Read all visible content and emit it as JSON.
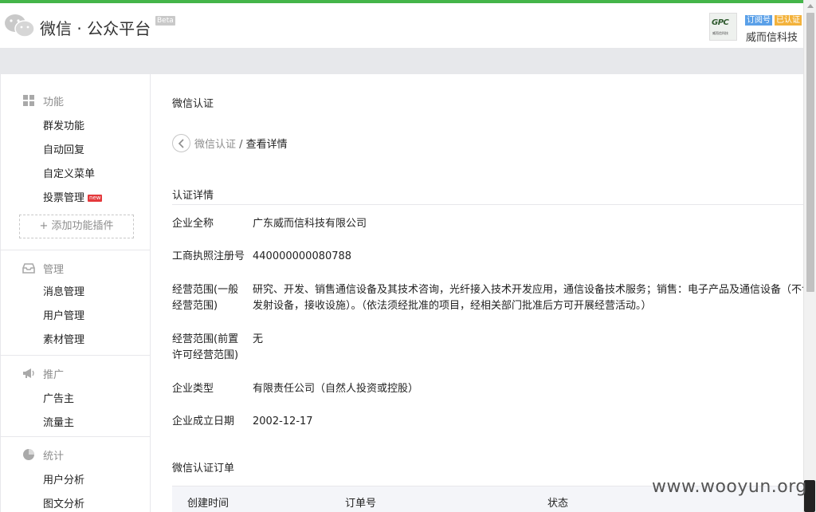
{
  "header": {
    "brand": "微信 · 公众平台",
    "beta": "Beta",
    "avatar_main": "GPC",
    "avatar_sub": "威而信科技",
    "tag_subscription": "订阅号",
    "tag_verified": "已认证",
    "account_name": "威而信科技"
  },
  "sidebar": {
    "function": {
      "title": "功能",
      "items": [
        "群发功能",
        "自动回复",
        "自定义菜单",
        "投票管理"
      ],
      "new_badge": "new",
      "add_plugin": "+ 添加功能插件"
    },
    "manage": {
      "title": "管理",
      "items": [
        "消息管理",
        "用户管理",
        "素材管理"
      ]
    },
    "promote": {
      "title": "推广",
      "items": [
        "广告主",
        "流量主"
      ]
    },
    "stats": {
      "title": "统计",
      "items": [
        "用户分析",
        "图文分析"
      ]
    }
  },
  "main": {
    "title": "微信认证",
    "breadcrumb": {
      "link": "微信认证",
      "sep": " / ",
      "current": "查看详情"
    },
    "details_title": "认证详情",
    "fields": [
      {
        "label": "企业全称",
        "value": [
          "广东威而信科技有限公司"
        ]
      },
      {
        "label": "工商执照注册号",
        "value": [
          "440000000080788"
        ]
      },
      {
        "label": "经营范围(一般经营范围)",
        "value": [
          "研究、开发、销售通信设备及其技术咨询，光纤接入技术开发应用，通信设备技术服务；销售：电子产品及通信设备（不含广播电视",
          "发射设备，接收设施）。（依法须经批准的项目，经相关部门批准后方可开展经营活动。）"
        ]
      },
      {
        "label": "经营范围(前置许可经营范围)",
        "value": [
          "无"
        ]
      },
      {
        "label": "企业类型",
        "value": [
          "有限责任公司（自然人投资或控股）"
        ]
      },
      {
        "label": "企业成立日期",
        "value": [
          "2002-12-17"
        ]
      }
    ],
    "orders_title": "微信认证订单",
    "orders_columns": [
      "创建时间",
      "订单号",
      "状态"
    ]
  },
  "watermark": "www.wooyun.org",
  "colors": {
    "accent": "#44b549",
    "tag_blue": "#5aa0e8",
    "tag_orange": "#f3b23b"
  }
}
